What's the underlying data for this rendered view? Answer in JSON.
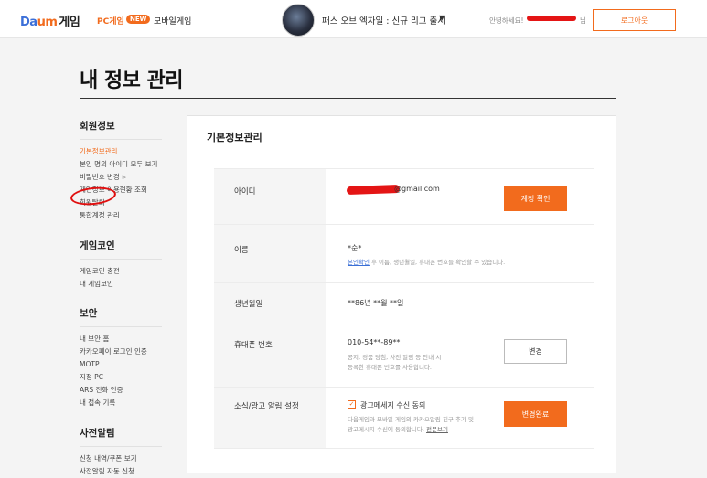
{
  "header": {
    "logo_brand": "Da",
    "logo_brand_m": "um",
    "logo_game": "게임",
    "nav_pc": "PC게임",
    "nav_new_badge": "NEW",
    "nav_mobile": "모바일게임",
    "banner_text": "패스 오브 엑자일 : 신규 리그 출시",
    "greeting_prefix": "안녕하세요!",
    "greeting_suffix": "님",
    "logout_label": "로그아웃"
  },
  "page": {
    "title": "내 정보 관리"
  },
  "sidebar": {
    "groups": [
      {
        "heading": "회원정보",
        "items": [
          "기본정보관리",
          "본인 명의 아이디 모두 보기",
          "비밀번호 변경",
          "개인정보 이용현황 조회",
          "회원탈퇴",
          "통합계정 관리"
        ]
      },
      {
        "heading": "게임코인",
        "items": [
          "게임코인 충전",
          "내 게임코인"
        ]
      },
      {
        "heading": "보안",
        "items": [
          "내 보안 홈",
          "카카오페이 로그인 인증",
          "MOTP",
          "지정 PC",
          "ARS 전화 인증",
          "내 접속 기록"
        ]
      },
      {
        "heading": "사전알림",
        "items": [
          "신청 내역/쿠폰 보기",
          "사전알림 자동 신청"
        ]
      }
    ]
  },
  "panel": {
    "title": "기본정보관리",
    "rows": {
      "id": {
        "label": "아이디",
        "value": "@gmail.com",
        "button": "계정 확인"
      },
      "name": {
        "label": "이름",
        "value": "*순*",
        "note_link": "본인확인",
        "note_text": " 후 이름, 생년월일, 휴대폰 번호를 확인할 수 있습니다."
      },
      "birth": {
        "label": "생년월일",
        "value": "**86년 **월 **일"
      },
      "phone": {
        "label": "휴대폰 번호",
        "value": "010-54**-89**",
        "note1": "공지, 경품 당첨, 사전 알림 등 안내 시",
        "note2": "등록한 휴대폰 번호를 사용합니다.",
        "button": "변경"
      },
      "ad": {
        "label": "소식/광고 알림 설정",
        "check_label": "광고메세지 수신 동의",
        "note1": "다음게임과 모바일 게임의 카카오알림 친구 추가 및",
        "note2": "광고메시지 수신에 동의합니다.",
        "note_link": "전문보기",
        "button": "변경완료"
      }
    }
  },
  "colors": {
    "accent": "#f26b1d",
    "link": "#3a6fd6",
    "redaction": "#e41515"
  }
}
